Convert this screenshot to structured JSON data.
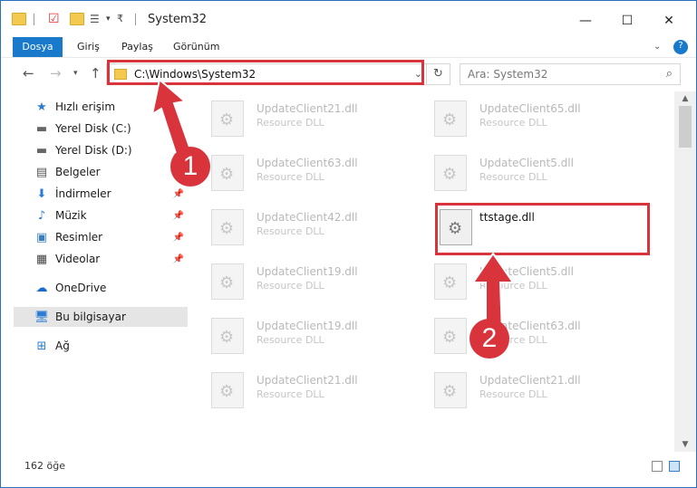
{
  "window": {
    "title": "System32",
    "controls": {
      "minimize": "—",
      "maximize": "☐",
      "close": "✕"
    }
  },
  "ribbon": {
    "tabs": [
      "Dosya",
      "Giriş",
      "Paylaş",
      "Görünüm"
    ],
    "expand_icon": "chevron-down-icon",
    "help_icon": "?"
  },
  "address": {
    "path": "C:\\Windows\\System32",
    "search_placeholder": "Ara: System32"
  },
  "sidebar": {
    "items": [
      {
        "label": "Hızlı erişim",
        "icon": "star-icon",
        "pinned": false
      },
      {
        "label": "Yerel Disk (C:)",
        "icon": "drive-icon",
        "pinned": true
      },
      {
        "label": "Yerel Disk (D:)",
        "icon": "drive-icon",
        "pinned": true
      },
      {
        "label": "Belgeler",
        "icon": "document-icon",
        "pinned": true
      },
      {
        "label": "İndirmeler",
        "icon": "download-icon",
        "pinned": true
      },
      {
        "label": "Müzik",
        "icon": "music-icon",
        "pinned": true
      },
      {
        "label": "Resimler",
        "icon": "pictures-icon",
        "pinned": true
      },
      {
        "label": "Videolar",
        "icon": "video-icon",
        "pinned": true
      },
      {
        "label": "OneDrive",
        "icon": "cloud-icon",
        "pinned": false
      },
      {
        "label": "Bu bilgisayar",
        "icon": "computer-icon",
        "pinned": false
      },
      {
        "label": "Ağ",
        "icon": "network-icon",
        "pinned": false
      }
    ]
  },
  "files": [
    {
      "name": "UpdateClient21.dll",
      "type": "Resource DLL"
    },
    {
      "name": "UpdateClient65.dll",
      "type": "Resource DLL"
    },
    {
      "name": "UpdateClient63.dll",
      "type": "Resource DLL"
    },
    {
      "name": "UpdateClient5.dll",
      "type": "Resource DLL"
    },
    {
      "name": "UpdateClient42.dll",
      "type": "Resource DLL"
    },
    {
      "name": "ttstage.dll",
      "type": ""
    },
    {
      "name": "UpdateClient19.dll",
      "type": "Resource DLL"
    },
    {
      "name": "UpdateClient5.dll",
      "type": "Resource DLL"
    },
    {
      "name": "UpdateClient19.dll",
      "type": "Resource DLL"
    },
    {
      "name": "UpdateClient63.dll",
      "type": "Resource DLL"
    },
    {
      "name": "UpdateClient21.dll",
      "type": "Resource DLL"
    },
    {
      "name": "UpdateClient21.dll",
      "type": "Resource DLL"
    }
  ],
  "status": {
    "count": "162 öğe"
  },
  "annotations": {
    "step1": "1",
    "step2": "2",
    "color": "#d9333c"
  }
}
